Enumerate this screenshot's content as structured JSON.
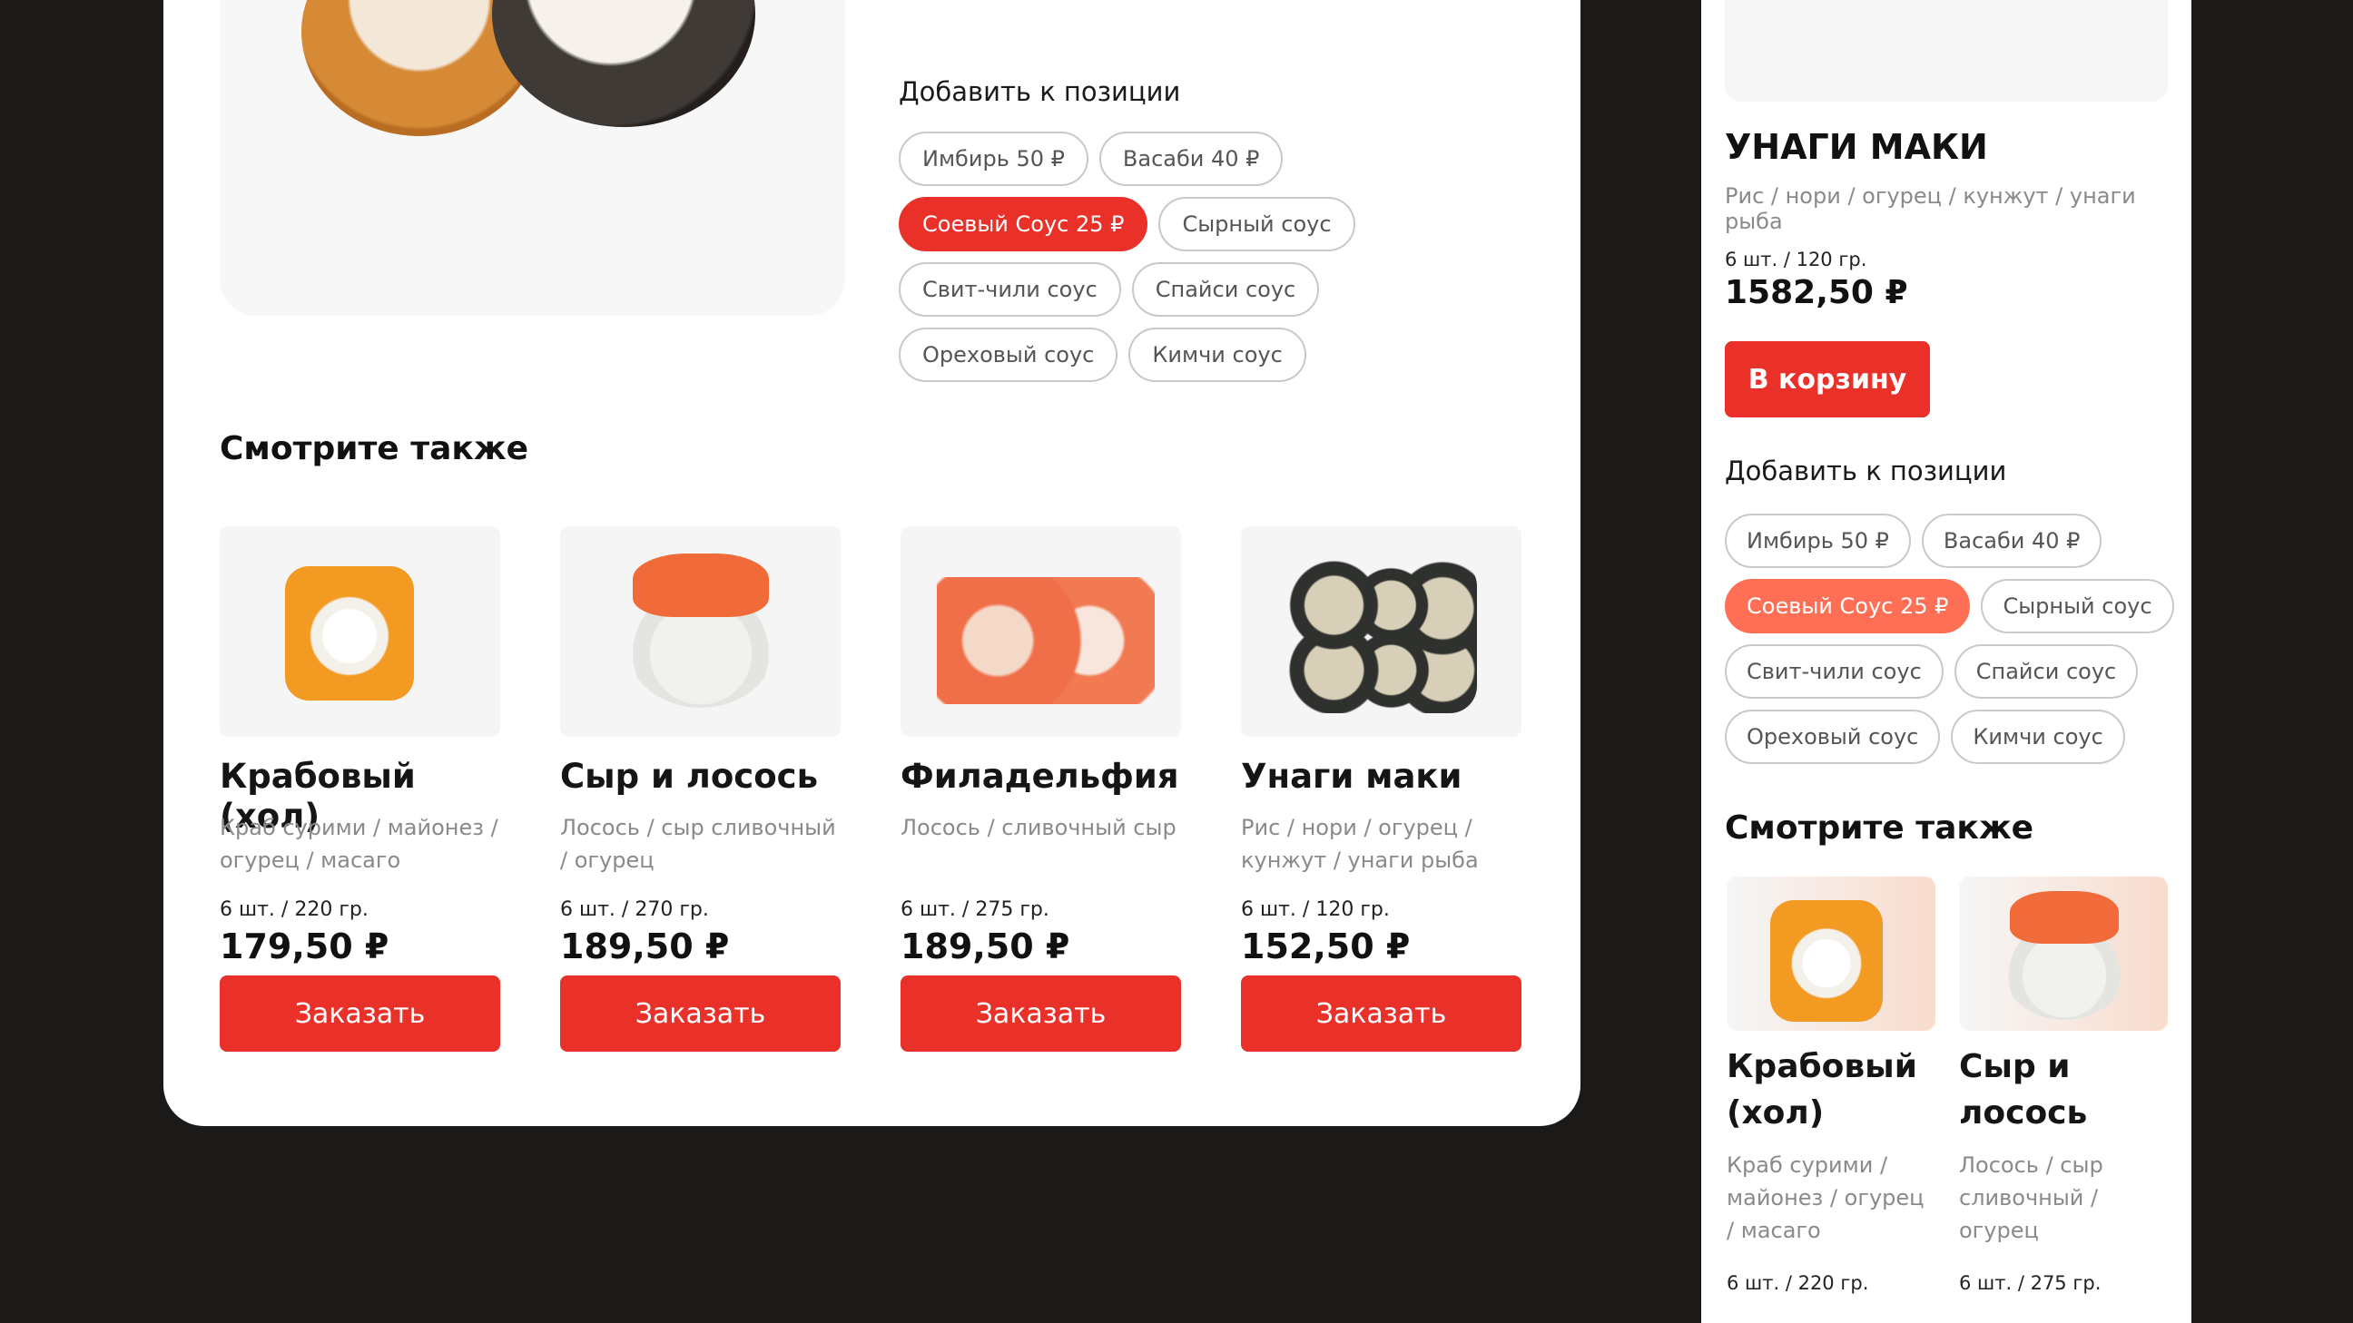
{
  "desktop": {
    "add_title": "Добавить к позиции",
    "addons": [
      {
        "label": "Имбирь 50 ₽",
        "active": false
      },
      {
        "label": "Васаби 40 ₽",
        "active": false
      },
      {
        "label": "Соевый Соус 25 ₽",
        "active": true
      },
      {
        "label": "Сырный соус",
        "active": false
      },
      {
        "label": "Свит-чили соус",
        "active": false
      },
      {
        "label": "Спайси соус",
        "active": false
      },
      {
        "label": "Ореховый соус",
        "active": false
      },
      {
        "label": "Кимчи соус",
        "active": false
      }
    ],
    "see_also_title": "Смотрите также",
    "products": [
      {
        "name": "Крабовый (хол)",
        "desc": "Краб сурими / майонез / огурец / масаго",
        "weight": "6 шт. / 220 гр.",
        "price": "179,50 ₽",
        "button": "Заказать",
        "image": "crab-roll"
      },
      {
        "name": "Сыр и лосось",
        "desc": "Лосось / сыр сливочный / огурец",
        "weight": "6 шт. / 270 гр.",
        "price": "189,50 ₽",
        "button": "Заказать",
        "image": "salmon-cheese-roll"
      },
      {
        "name": "Филадельфия",
        "desc": "Лосось / сливочный сыр",
        "weight": "6 шт. / 275 гр.",
        "price": "189,50 ₽",
        "button": "Заказать",
        "image": "philadelphia-roll"
      },
      {
        "name": "Унаги маки",
        "desc": "Рис / нори / огурец / кунжут / унаги рыба",
        "weight": "6 шт. / 120 гр.",
        "price": "152,50 ₽",
        "button": "Заказать",
        "image": "unagi-maki"
      }
    ]
  },
  "mobile": {
    "title": "УНАГИ МАКИ",
    "desc": "Рис / нори / огурец / кунжут / унаги рыба",
    "weight": "6 шт. / 120 гр.",
    "price": "1582,50 ₽",
    "cart_button": "В корзину",
    "add_title": "Добавить к позиции",
    "addons": [
      {
        "label": "Имбирь 50 ₽",
        "active": false
      },
      {
        "label": "Васаби 40 ₽",
        "active": false
      },
      {
        "label": "Соевый Соус 25 ₽",
        "active": true
      },
      {
        "label": "Сырный соус",
        "active": false
      },
      {
        "label": "Свит-чили соус",
        "active": false
      },
      {
        "label": "Спайси соус",
        "active": false
      },
      {
        "label": "Ореховый соус",
        "active": false
      },
      {
        "label": "Кимчи соус",
        "active": false
      }
    ],
    "see_also_title": "Смотрите также",
    "products": [
      {
        "name": "Крабовый (хол)",
        "desc": "Краб сурими / майонез / огурец / масаго",
        "weight": "6 шт. / 220 гр.",
        "image": "crab-roll"
      },
      {
        "name": "Сыр и лосось",
        "desc": "Лосось / сыр сливочный / огурец",
        "weight": "6 шт. / 275 гр.",
        "image": "salmon-cheese-roll"
      }
    ]
  },
  "colors": {
    "accent": "#e9312a",
    "accent_soft": "#ff6f55",
    "background": "#1c1919"
  }
}
